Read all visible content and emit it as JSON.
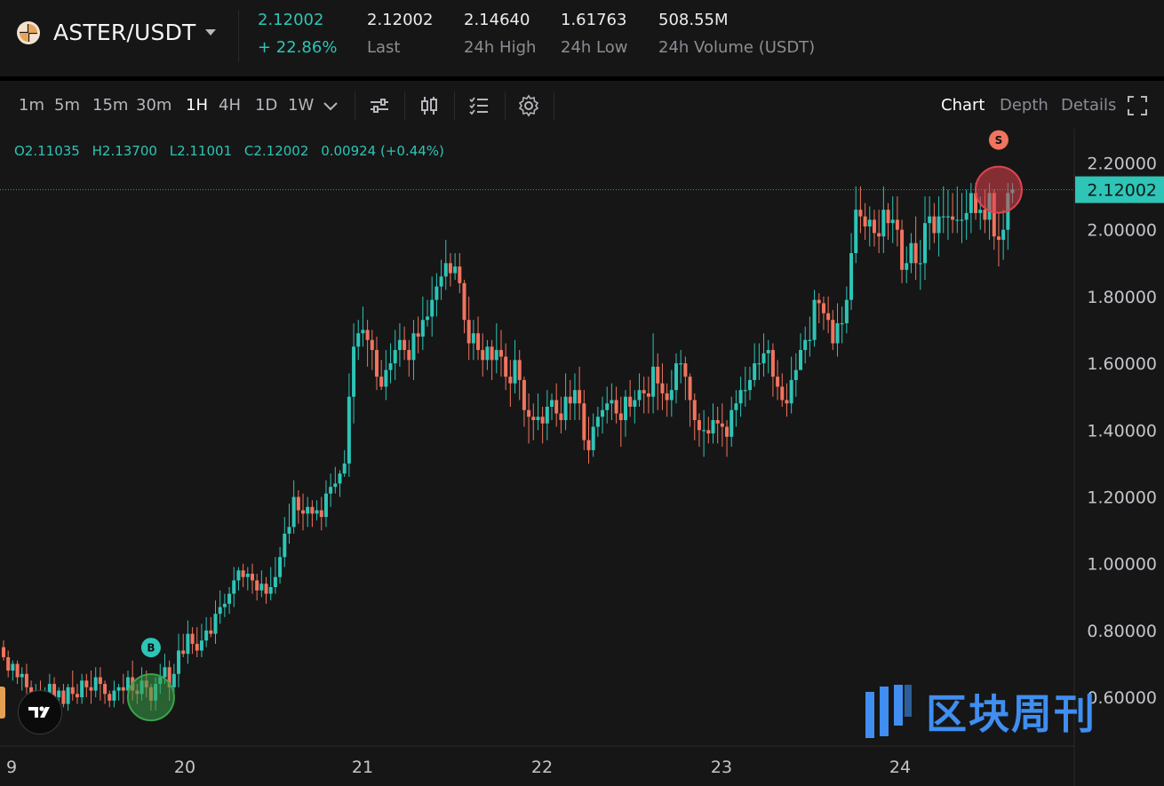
{
  "header": {
    "pair": "ASTER/USDT",
    "price": "2.12002",
    "change": "+ 22.86%",
    "stats": [
      {
        "value": "2.12002",
        "label": "Last"
      },
      {
        "value": "2.14640",
        "label": "24h High"
      },
      {
        "value": "1.61763",
        "label": "24h Low"
      },
      {
        "value": "508.55M",
        "label": "24h Volume (USDT)"
      }
    ]
  },
  "toolbar": {
    "timeframes": [
      "1m",
      "5m",
      "15m",
      "30m",
      "1H",
      "4H",
      "1D",
      "1W"
    ],
    "active_timeframe": "1H",
    "icons": [
      "chevron-down-icon",
      "indicator-icon",
      "candle-type-icon",
      "checklist-icon",
      "gear-icon"
    ],
    "views": [
      "Chart",
      "Depth",
      "Details"
    ],
    "active_view": "Chart"
  },
  "ohlc": {
    "open": "O2.11035",
    "high": "H2.13700",
    "low": "L2.11001",
    "close": "C2.12002",
    "change": "0.00924 (+0.44%)"
  },
  "watermark": "区块周刊",
  "colors": {
    "up": "#2ec4b6",
    "down": "#f0745e",
    "background": "#161616",
    "watermark": "#3f8ef0"
  },
  "chart_data": {
    "type": "candlestick",
    "interval": "1H",
    "x_ticks": [
      "9",
      "20",
      "21",
      "22",
      "23",
      "24"
    ],
    "y_ticks": [
      "2.20000",
      "2.00000",
      "1.80000",
      "1.60000",
      "1.40000",
      "1.20000",
      "1.00000",
      "0.80000",
      "0.60000"
    ],
    "ylim": [
      0.55,
      2.27
    ],
    "last_price": "2.12002",
    "markers": [
      {
        "label": "B",
        "time_index": 32,
        "price": 0.6
      },
      {
        "label": "S",
        "time_index": 216,
        "price": 2.12
      }
    ],
    "close": [
      0.72,
      0.68,
      0.7,
      0.66,
      0.67,
      0.63,
      0.6,
      0.62,
      0.59,
      0.61,
      0.64,
      0.6,
      0.62,
      0.58,
      0.63,
      0.61,
      0.6,
      0.65,
      0.63,
      0.62,
      0.66,
      0.64,
      0.61,
      0.59,
      0.62,
      0.63,
      0.62,
      0.66,
      0.62,
      0.61,
      0.65,
      0.63,
      0.59,
      0.64,
      0.66,
      0.69,
      0.63,
      0.67,
      0.74,
      0.73,
      0.79,
      0.76,
      0.74,
      0.77,
      0.8,
      0.79,
      0.85,
      0.87,
      0.88,
      0.91,
      0.95,
      0.98,
      0.96,
      0.97,
      0.95,
      0.92,
      0.94,
      0.91,
      0.93,
      0.96,
      1.02,
      1.09,
      1.11,
      1.2,
      1.16,
      1.15,
      1.17,
      1.15,
      1.16,
      1.14,
      1.21,
      1.23,
      1.24,
      1.27,
      1.3,
      1.5,
      1.65,
      1.69,
      1.7,
      1.67,
      1.64,
      1.56,
      1.53,
      1.58,
      1.6,
      1.64,
      1.67,
      1.64,
      1.61,
      1.69,
      1.68,
      1.73,
      1.74,
      1.79,
      1.83,
      1.86,
      1.9,
      1.87,
      1.89,
      1.84,
      1.73,
      1.66,
      1.69,
      1.64,
      1.61,
      1.65,
      1.61,
      1.64,
      1.62,
      1.56,
      1.54,
      1.61,
      1.55,
      1.46,
      1.44,
      1.43,
      1.44,
      1.42,
      1.47,
      1.49,
      1.45,
      1.43,
      1.5,
      1.48,
      1.52,
      1.48,
      1.37,
      1.34,
      1.41,
      1.44,
      1.46,
      1.48,
      1.49,
      1.45,
      1.43,
      1.5,
      1.47,
      1.49,
      1.52,
      1.51,
      1.5,
      1.59,
      1.54,
      1.51,
      1.49,
      1.52,
      1.6,
      1.6,
      1.56,
      1.49,
      1.43,
      1.4,
      1.4,
      1.39,
      1.43,
      1.42,
      1.41,
      1.38,
      1.46,
      1.48,
      1.52,
      1.52,
      1.55,
      1.6,
      1.6,
      1.63,
      1.64,
      1.56,
      1.53,
      1.49,
      1.48,
      1.55,
      1.58,
      1.64,
      1.67,
      1.67,
      1.79,
      1.78,
      1.75,
      1.73,
      1.66,
      1.72,
      1.72,
      1.79,
      1.93,
      2.06,
      2.04,
      2.01,
      2.03,
      1.99,
      1.98,
      2.06,
      2.02,
      2.03,
      2.0,
      1.88,
      1.9,
      1.96,
      1.9,
      1.9,
      2.02,
      2.04,
      1.99,
      2.04,
      2.04,
      2.04,
      2.03,
      2.03,
      2.03,
      2.05,
      2.11,
      2.05,
      2.06,
      2.03,
      2.11,
      1.98,
      1.97,
      2.0,
      2.11,
      2.12
    ],
    "open": [
      0.75,
      0.72,
      0.68,
      0.7,
      0.66,
      0.67,
      0.63,
      0.6,
      0.62,
      0.59,
      0.61,
      0.64,
      0.6,
      0.62,
      0.58,
      0.63,
      0.61,
      0.6,
      0.65,
      0.63,
      0.62,
      0.66,
      0.64,
      0.61,
      0.59,
      0.62,
      0.63,
      0.62,
      0.66,
      0.62,
      0.61,
      0.65,
      0.63,
      0.59,
      0.64,
      0.66,
      0.69,
      0.63,
      0.67,
      0.74,
      0.73,
      0.79,
      0.76,
      0.74,
      0.77,
      0.8,
      0.79,
      0.85,
      0.87,
      0.88,
      0.91,
      0.95,
      0.98,
      0.96,
      0.97,
      0.95,
      0.92,
      0.94,
      0.91,
      0.93,
      0.96,
      1.02,
      1.09,
      1.11,
      1.2,
      1.16,
      1.15,
      1.17,
      1.15,
      1.16,
      1.14,
      1.21,
      1.23,
      1.24,
      1.27,
      1.3,
      1.5,
      1.65,
      1.69,
      1.7,
      1.67,
      1.64,
      1.56,
      1.53,
      1.58,
      1.6,
      1.64,
      1.67,
      1.64,
      1.61,
      1.69,
      1.68,
      1.73,
      1.74,
      1.79,
      1.83,
      1.86,
      1.9,
      1.87,
      1.89,
      1.84,
      1.73,
      1.66,
      1.69,
      1.64,
      1.61,
      1.65,
      1.61,
      1.64,
      1.62,
      1.56,
      1.54,
      1.61,
      1.55,
      1.46,
      1.44,
      1.43,
      1.44,
      1.42,
      1.47,
      1.49,
      1.45,
      1.43,
      1.5,
      1.48,
      1.52,
      1.48,
      1.37,
      1.34,
      1.41,
      1.44,
      1.46,
      1.48,
      1.49,
      1.45,
      1.43,
      1.5,
      1.47,
      1.49,
      1.52,
      1.51,
      1.5,
      1.59,
      1.54,
      1.51,
      1.49,
      1.52,
      1.6,
      1.6,
      1.56,
      1.49,
      1.43,
      1.4,
      1.4,
      1.39,
      1.43,
      1.42,
      1.41,
      1.38,
      1.46,
      1.48,
      1.52,
      1.52,
      1.55,
      1.6,
      1.6,
      1.63,
      1.64,
      1.56,
      1.53,
      1.49,
      1.48,
      1.55,
      1.58,
      1.64,
      1.67,
      1.67,
      1.79,
      1.78,
      1.75,
      1.73,
      1.66,
      1.72,
      1.72,
      1.79,
      1.93,
      2.06,
      2.04,
      2.01,
      2.03,
      1.99,
      1.98,
      2.06,
      2.02,
      2.03,
      2.0,
      1.88,
      1.9,
      1.96,
      1.9,
      1.9,
      2.02,
      2.04,
      1.99,
      2.04,
      2.04,
      2.04,
      2.03,
      2.03,
      2.03,
      2.05,
      2.11,
      2.05,
      2.06,
      2.03,
      2.11,
      1.98,
      1.97,
      2.0,
      2.11
    ],
    "high": [
      0.77,
      0.74,
      0.71,
      0.71,
      0.69,
      0.7,
      0.65,
      0.64,
      0.65,
      0.63,
      0.67,
      0.66,
      0.63,
      0.64,
      0.64,
      0.68,
      0.64,
      0.67,
      0.67,
      0.68,
      0.69,
      0.69,
      0.65,
      0.62,
      0.65,
      0.64,
      0.67,
      0.68,
      0.71,
      0.64,
      0.69,
      0.68,
      0.64,
      0.66,
      0.7,
      0.73,
      0.71,
      0.7,
      0.79,
      0.79,
      0.83,
      0.81,
      0.81,
      0.82,
      0.84,
      0.84,
      0.89,
      0.92,
      0.91,
      0.93,
      0.99,
      0.99,
      1.0,
      0.99,
      1.0,
      0.97,
      0.98,
      0.96,
      0.99,
      1.02,
      1.05,
      1.14,
      1.18,
      1.25,
      1.22,
      1.21,
      1.2,
      1.19,
      1.19,
      1.2,
      1.25,
      1.27,
      1.29,
      1.28,
      1.34,
      1.57,
      1.72,
      1.73,
      1.77,
      1.73,
      1.7,
      1.68,
      1.61,
      1.64,
      1.66,
      1.7,
      1.72,
      1.71,
      1.67,
      1.73,
      1.74,
      1.8,
      1.79,
      1.86,
      1.87,
      1.91,
      1.97,
      1.93,
      1.93,
      1.93,
      1.85,
      1.8,
      1.73,
      1.74,
      1.69,
      1.67,
      1.67,
      1.72,
      1.7,
      1.66,
      1.61,
      1.67,
      1.64,
      1.56,
      1.51,
      1.48,
      1.51,
      1.47,
      1.52,
      1.51,
      1.54,
      1.5,
      1.57,
      1.55,
      1.57,
      1.59,
      1.52,
      1.44,
      1.45,
      1.47,
      1.5,
      1.53,
      1.54,
      1.53,
      1.5,
      1.52,
      1.55,
      1.52,
      1.57,
      1.56,
      1.56,
      1.69,
      1.63,
      1.6,
      1.54,
      1.58,
      1.63,
      1.64,
      1.62,
      1.57,
      1.51,
      1.45,
      1.46,
      1.44,
      1.48,
      1.47,
      1.48,
      1.43,
      1.5,
      1.52,
      1.56,
      1.59,
      1.59,
      1.66,
      1.66,
      1.69,
      1.67,
      1.66,
      1.61,
      1.57,
      1.54,
      1.62,
      1.63,
      1.69,
      1.71,
      1.74,
      1.82,
      1.81,
      1.8,
      1.8,
      1.76,
      1.78,
      1.77,
      1.83,
      1.99,
      2.13,
      2.13,
      2.08,
      2.07,
      2.06,
      2.06,
      2.13,
      2.08,
      2.1,
      2.1,
      2.03,
      1.95,
      1.99,
      2.04,
      1.97,
      2.1,
      2.1,
      2.08,
      2.1,
      2.13,
      2.12,
      2.11,
      2.13,
      2.11,
      2.12,
      2.14,
      2.14,
      2.1,
      2.12,
      2.14,
      2.12,
      2.05,
      2.06,
      2.14,
      2.14
    ],
    "low": [
      0.71,
      0.66,
      0.65,
      0.64,
      0.62,
      0.61,
      0.57,
      0.56,
      0.57,
      0.57,
      0.59,
      0.58,
      0.57,
      0.57,
      0.56,
      0.59,
      0.58,
      0.58,
      0.6,
      0.58,
      0.6,
      0.59,
      0.58,
      0.57,
      0.57,
      0.59,
      0.58,
      0.59,
      0.59,
      0.58,
      0.59,
      0.6,
      0.56,
      0.56,
      0.61,
      0.64,
      0.59,
      0.61,
      0.63,
      0.72,
      0.7,
      0.73,
      0.72,
      0.72,
      0.75,
      0.78,
      0.76,
      0.82,
      0.84,
      0.85,
      0.87,
      0.92,
      0.93,
      0.92,
      0.91,
      0.89,
      0.9,
      0.88,
      0.89,
      0.91,
      0.94,
      0.99,
      1.06,
      1.09,
      1.12,
      1.1,
      1.11,
      1.11,
      1.13,
      1.1,
      1.11,
      1.17,
      1.21,
      1.2,
      1.26,
      1.26,
      1.42,
      1.61,
      1.65,
      1.59,
      1.58,
      1.52,
      1.52,
      1.49,
      1.54,
      1.55,
      1.59,
      1.61,
      1.56,
      1.55,
      1.63,
      1.64,
      1.71,
      1.68,
      1.74,
      1.79,
      1.82,
      1.83,
      1.85,
      1.81,
      1.69,
      1.61,
      1.61,
      1.61,
      1.56,
      1.58,
      1.55,
      1.57,
      1.56,
      1.52,
      1.47,
      1.51,
      1.49,
      1.41,
      1.36,
      1.37,
      1.4,
      1.36,
      1.37,
      1.43,
      1.41,
      1.39,
      1.4,
      1.43,
      1.43,
      1.43,
      1.34,
      1.3,
      1.32,
      1.38,
      1.39,
      1.42,
      1.43,
      1.42,
      1.35,
      1.38,
      1.44,
      1.42,
      1.47,
      1.45,
      1.45,
      1.45,
      1.46,
      1.46,
      1.44,
      1.44,
      1.48,
      1.54,
      1.49,
      1.41,
      1.37,
      1.35,
      1.32,
      1.36,
      1.36,
      1.36,
      1.35,
      1.32,
      1.35,
      1.41,
      1.44,
      1.47,
      1.49,
      1.53,
      1.55,
      1.56,
      1.57,
      1.5,
      1.49,
      1.47,
      1.44,
      1.45,
      1.5,
      1.59,
      1.6,
      1.62,
      1.65,
      1.72,
      1.7,
      1.69,
      1.64,
      1.62,
      1.66,
      1.69,
      1.76,
      1.9,
      1.99,
      1.97,
      1.95,
      1.95,
      1.93,
      1.93,
      1.97,
      1.96,
      1.95,
      1.84,
      1.84,
      1.87,
      1.85,
      1.82,
      1.85,
      1.94,
      1.96,
      1.92,
      1.99,
      1.97,
      1.99,
      1.99,
      1.96,
      1.97,
      1.99,
      2.03,
      2.0,
      1.99,
      1.97,
      1.94,
      1.89,
      1.91,
      1.94,
      2.08
    ]
  }
}
